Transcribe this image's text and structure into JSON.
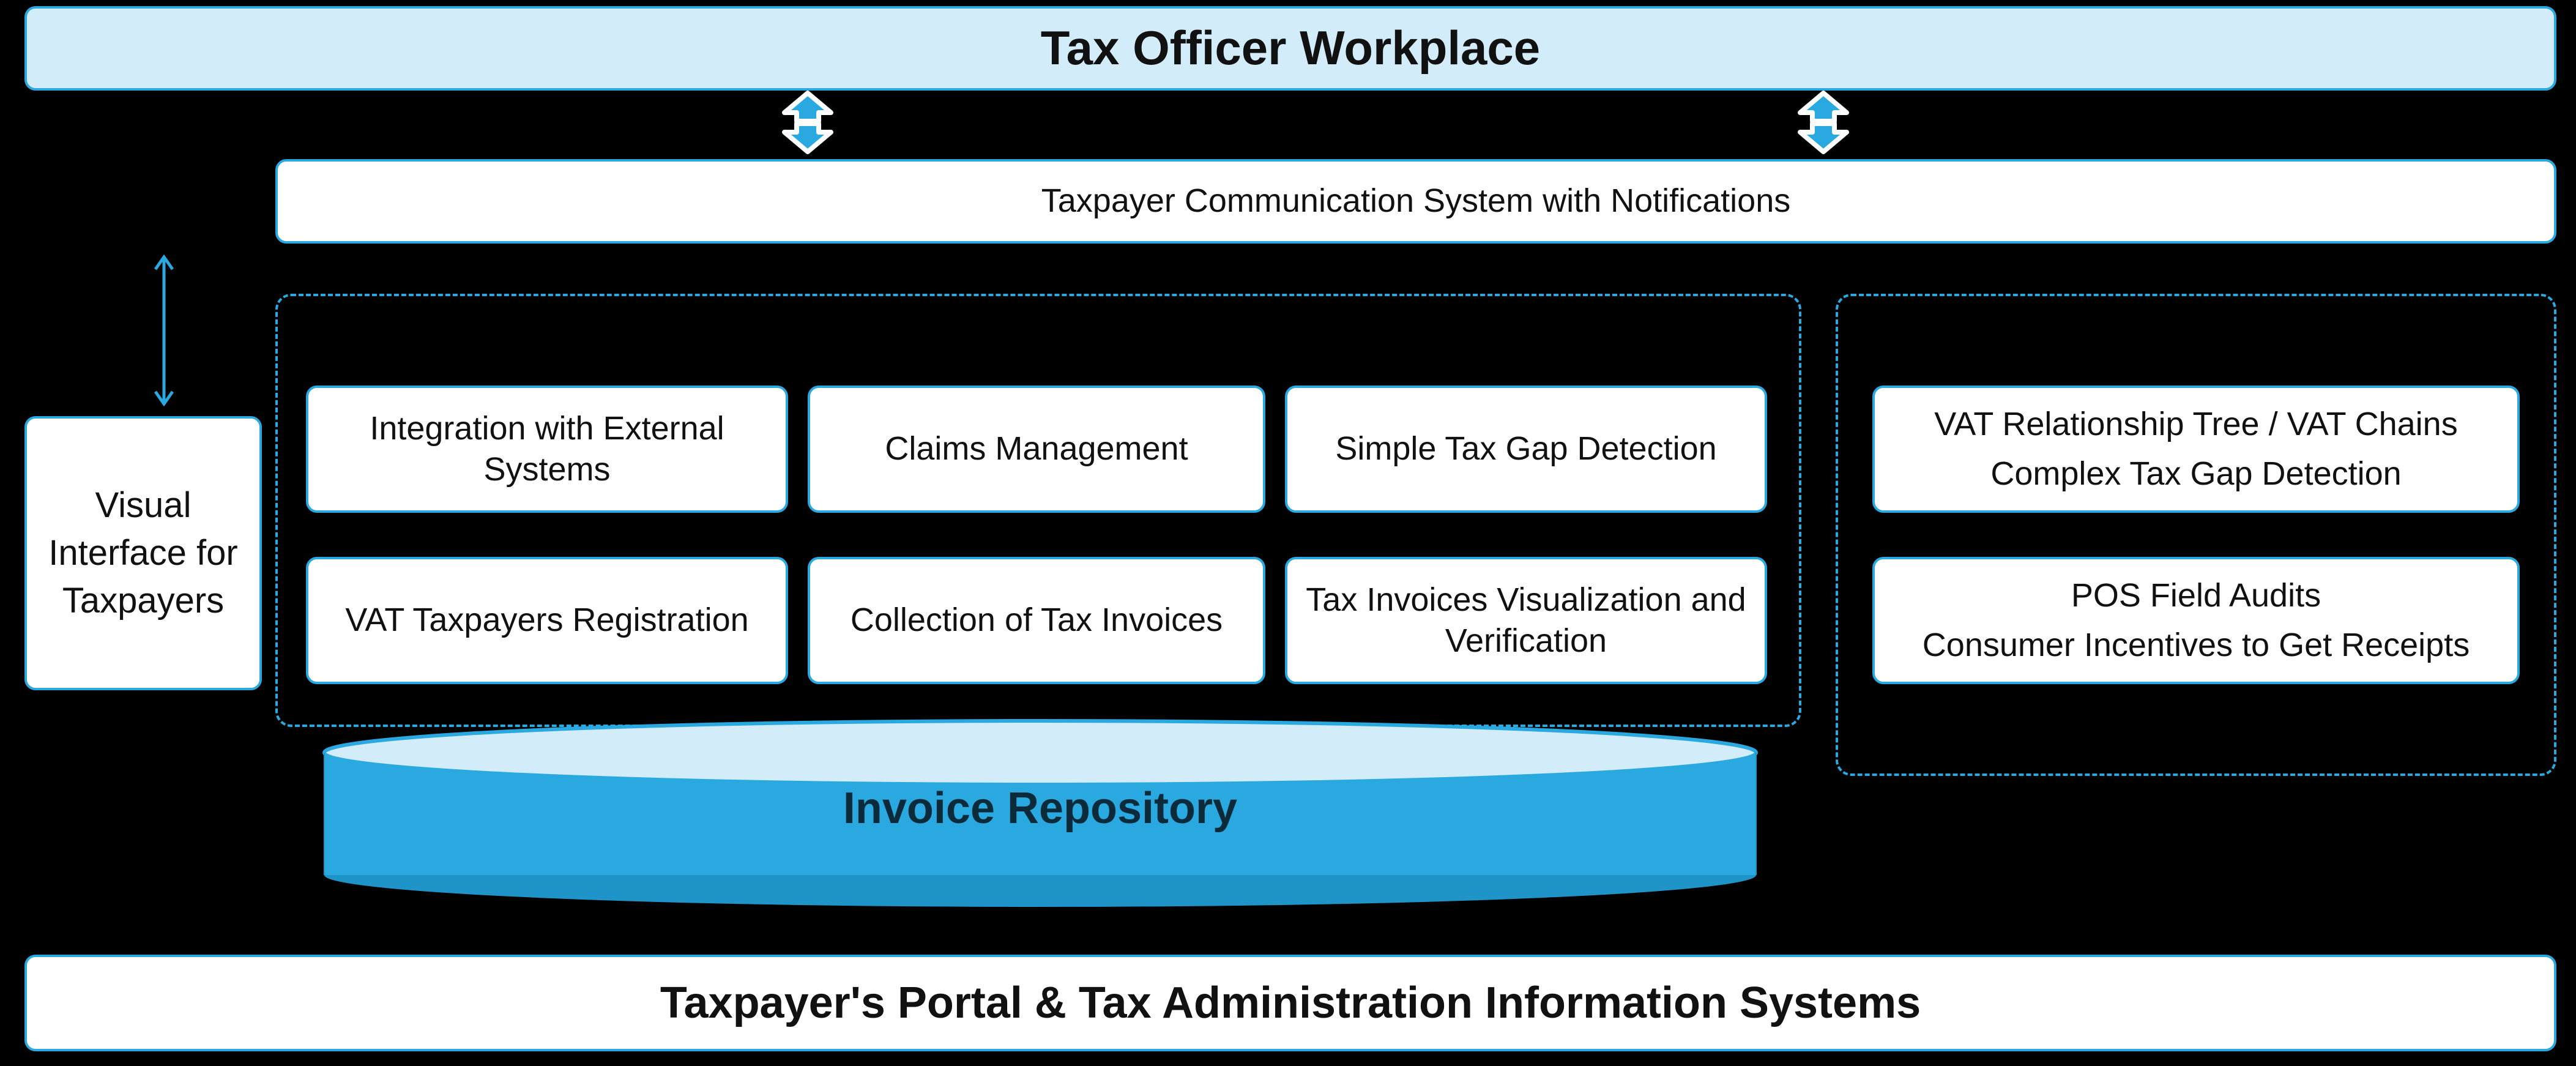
{
  "headerTitle": "Tax Officer Workplace",
  "commSystem": "Taxpayer Communication System with Notifications",
  "visualInterface": "Visual Interface for Taxpayers",
  "left": {
    "r1c1": "Integration with External Systems",
    "r1c2": "Claims Management",
    "r1c3": "Simple Tax Gap Detection",
    "r2c1": "VAT Taxpayers Registration",
    "r2c2": "Collection of Tax Invoices",
    "r2c3": "Tax Invoices Visualization and Verification"
  },
  "right": {
    "top1": "VAT Relationship Tree / VAT Chains",
    "top2": "Complex Tax Gap Detection",
    "bot1": "POS Field Audits",
    "bot2": "Consumer Incentives to Get Receipts"
  },
  "repository": "Invoice Repository",
  "footer": "Taxpayer's Portal & Tax Administration Information Systems"
}
